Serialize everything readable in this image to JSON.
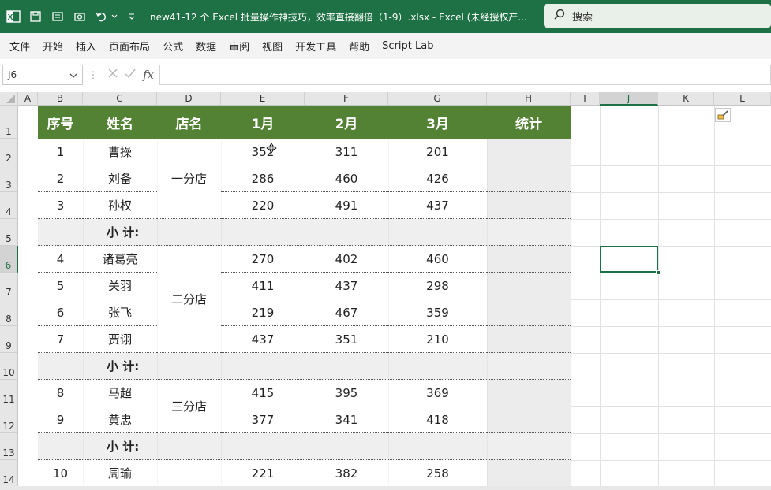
{
  "window": {
    "title": "new41-12 个 Excel 批量操作神技巧，效率直接翻倍（1-9）.xlsx  -  Excel (未经授权产...",
    "search_placeholder": "搜索",
    "accent": "#1e7145"
  },
  "menu": [
    "文件",
    "开始",
    "插入",
    "页面布局",
    "公式",
    "数据",
    "审阅",
    "视图",
    "开发工具",
    "帮助",
    "Script Lab"
  ],
  "formula_bar": {
    "name_box": "J6",
    "formula": "",
    "fx_label": "fx"
  },
  "columns": [
    "A",
    "B",
    "C",
    "D",
    "E",
    "F",
    "G",
    "H",
    "I",
    "J",
    "K",
    "L"
  ],
  "selected_column": "J",
  "selected_row": "6",
  "rows": [
    "1",
    "2",
    "3",
    "4",
    "5",
    "6",
    "7",
    "8",
    "9",
    "10",
    "11",
    "12",
    "13",
    "14"
  ],
  "table": {
    "header": {
      "seq": "序号",
      "name": "姓名",
      "store": "店名",
      "m1": "1月",
      "m2": "2月",
      "m3": "3月",
      "stat": "统计"
    },
    "header_color": "#548235",
    "stores": [
      "一分店",
      "二分店",
      "三分店"
    ],
    "subtotal_label": "小  计:",
    "records": [
      {
        "seq": "1",
        "name": "曹操",
        "m1": "352",
        "m2": "311",
        "m3": "201"
      },
      {
        "seq": "2",
        "name": "刘备",
        "m1": "286",
        "m2": "460",
        "m3": "426"
      },
      {
        "seq": "3",
        "name": "孙权",
        "m1": "220",
        "m2": "491",
        "m3": "437"
      },
      {
        "seq": "4",
        "name": "诸葛亮",
        "m1": "270",
        "m2": "402",
        "m3": "460"
      },
      {
        "seq": "5",
        "name": "关羽",
        "m1": "411",
        "m2": "437",
        "m3": "298"
      },
      {
        "seq": "6",
        "name": "张飞",
        "m1": "219",
        "m2": "467",
        "m3": "359"
      },
      {
        "seq": "7",
        "name": "贾诩",
        "m1": "437",
        "m2": "351",
        "m3": "210"
      },
      {
        "seq": "8",
        "name": "马超",
        "m1": "415",
        "m2": "395",
        "m3": "369"
      },
      {
        "seq": "9",
        "name": "黄忠",
        "m1": "377",
        "m2": "341",
        "m3": "418"
      },
      {
        "seq": "10",
        "name": "周瑜",
        "m1": "221",
        "m2": "382",
        "m3": "258"
      }
    ]
  }
}
